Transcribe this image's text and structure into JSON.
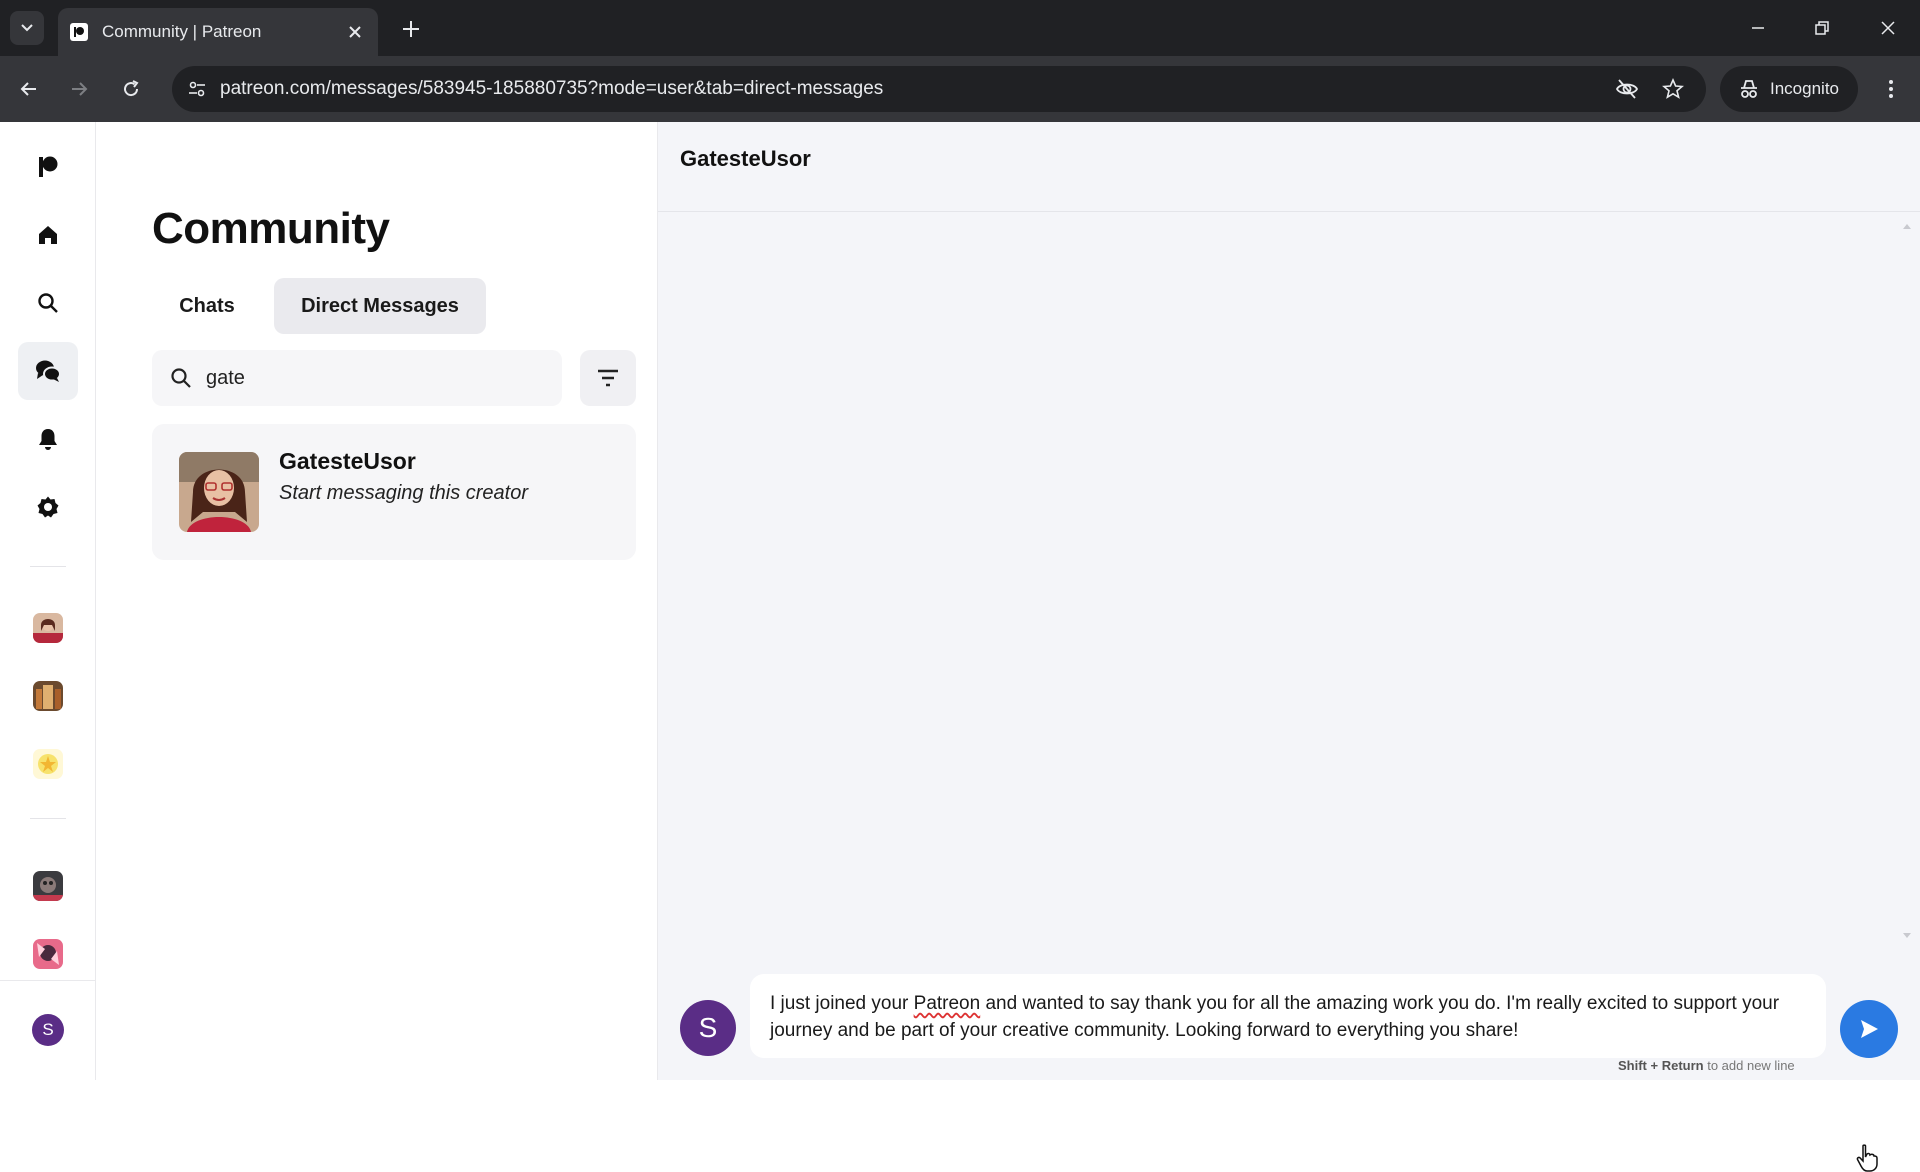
{
  "browser": {
    "tab_title": "Community | Patreon",
    "url": "patreon.com/messages/583945-185880735?mode=user&tab=direct-messages",
    "incognito_label": "Incognito"
  },
  "rail": {
    "items": [
      "patreon-logo",
      "home",
      "search",
      "community",
      "notifications",
      "settings"
    ]
  },
  "list": {
    "title": "Community",
    "tabs": [
      {
        "label": "Chats",
        "active": false
      },
      {
        "label": "Direct Messages",
        "active": true
      }
    ],
    "search": {
      "value": "gate"
    },
    "results": [
      {
        "name": "GatesteUsor",
        "subtitle": "Start messaging this creator"
      }
    ]
  },
  "user": {
    "initial": "S"
  },
  "chat": {
    "title": "GatesteUsor",
    "composer": {
      "text_before": "I just joined your ",
      "misspelled_word": "Patreon",
      "text_after": " and wanted to say thank you for all the amazing work you do. I'm really excited to support your journey and be part of your creative community. Looking forward to everything you share!"
    },
    "hint_keys": "Shift + Return",
    "hint_text": " to add new line"
  },
  "colors": {
    "accent_send": "#2a7ae2",
    "user_avatar": "#5a2d86",
    "chat_bg": "#f4f5f9"
  }
}
